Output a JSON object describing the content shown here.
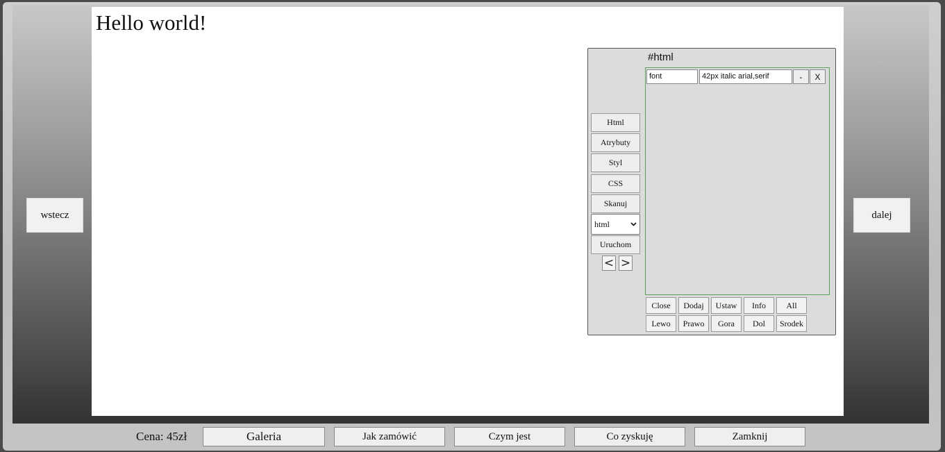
{
  "canvas": {
    "heading": "Hello world!"
  },
  "nav": {
    "prev_label": "wstecz",
    "next_label": "dalej"
  },
  "inspector": {
    "title": "#html",
    "side_buttons": [
      "Html",
      "Atrybuty",
      "Styl",
      "CSS",
      "Skanuj"
    ],
    "tag_select_value": "html",
    "run_label": "Uruchom",
    "prev_arrow": "<",
    "next_arrow": ">",
    "property": {
      "name": "font",
      "value": "42px italic arial,serif"
    },
    "minus_label": "-",
    "remove_label": "X",
    "grid_row1": [
      "Close",
      "Dodaj",
      "Ustaw",
      "Info",
      "All"
    ],
    "grid_row2": [
      "Lewo",
      "Prawo",
      "Gora",
      "Dol",
      "Srodek"
    ]
  },
  "footer": {
    "price": "Cena: 45zł",
    "buttons": [
      "Galeria",
      "Jak zamówić",
      "Czym jest",
      "Co zyskuję",
      "Zamknij"
    ]
  }
}
